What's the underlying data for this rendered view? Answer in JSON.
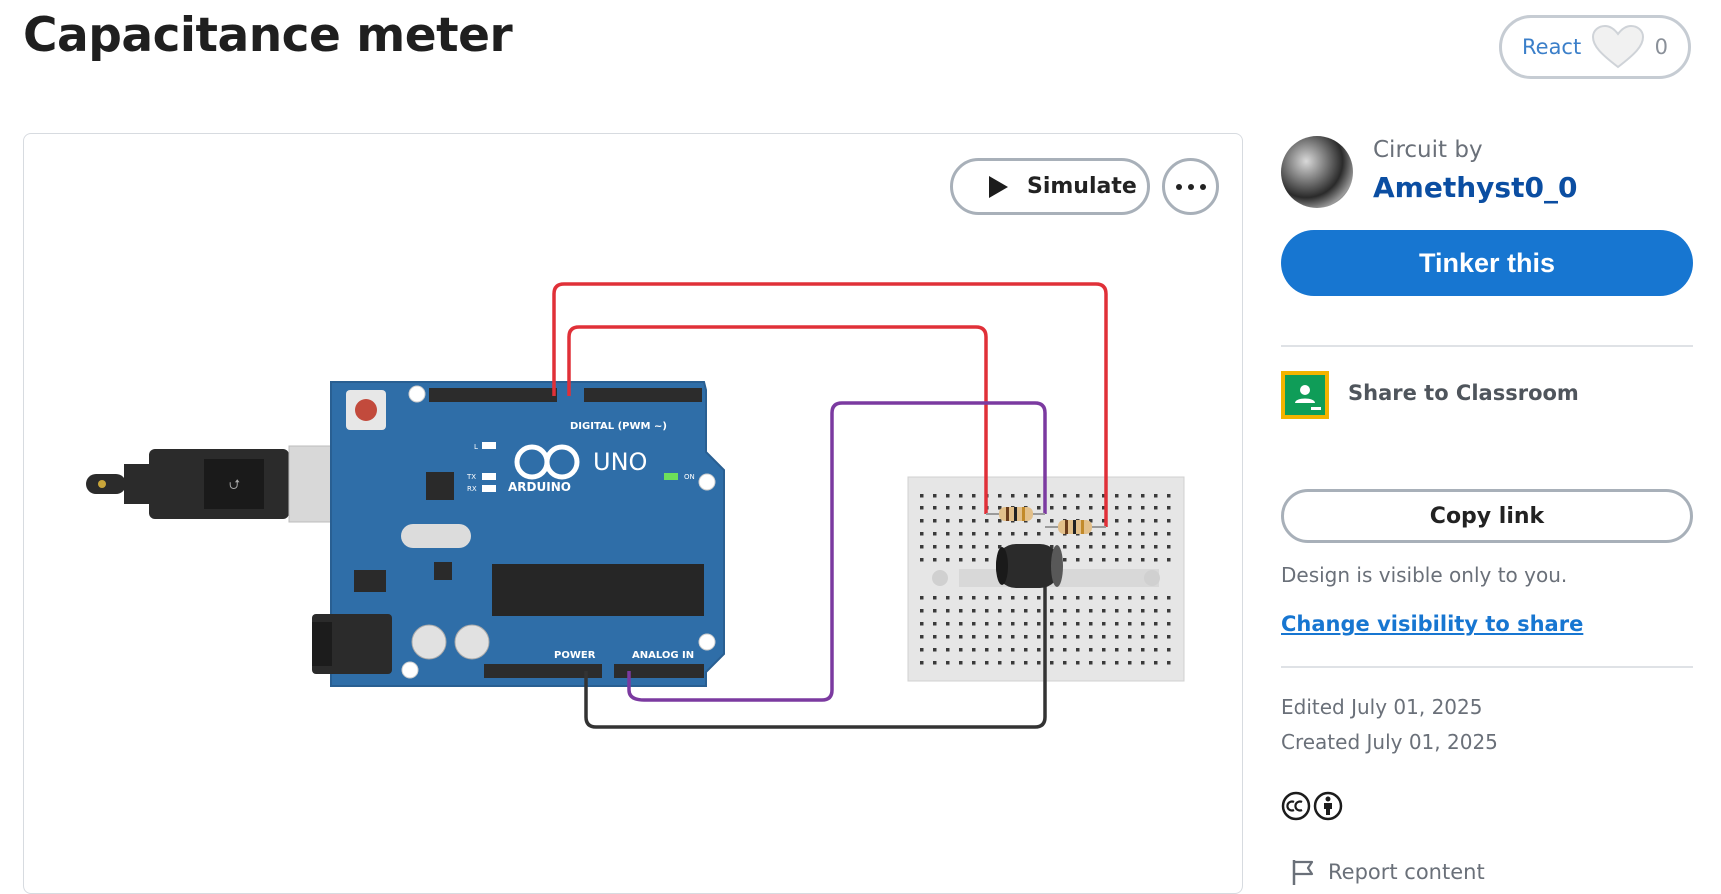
{
  "page": {
    "title": "Capacitance meter"
  },
  "react": {
    "label": "React",
    "count": "0"
  },
  "viewer": {
    "simulate_label": "Simulate"
  },
  "board": {
    "brand": "ARDUINO",
    "model": "UNO",
    "digital_label": "DIGITAL (PWM ~)",
    "power_label": "POWER",
    "analog_label": "ANALOG IN",
    "on_label": "ON",
    "tx_label": "TX",
    "rx_label": "RX",
    "l_label": "L"
  },
  "author_panel": {
    "circuit_by": "Circuit by",
    "author_name": "Amethyst0_0",
    "tinker_label": "Tinker this"
  },
  "share": {
    "classroom_label": "Share to Classroom",
    "copy_link_label": "Copy link",
    "visibility_note": "Design is visible only to you.",
    "change_visibility_label": "Change visibility to share"
  },
  "meta": {
    "edited": "Edited July 01, 2025",
    "created": "Created July 01, 2025",
    "report_label": "Report content"
  },
  "colors": {
    "primary": "#1776d1",
    "author_link": "#0b4ea2",
    "wire_red": "#e03038",
    "wire_purple": "#7b3aa0",
    "wire_black": "#333333",
    "board_blue": "#2f6ea8"
  }
}
